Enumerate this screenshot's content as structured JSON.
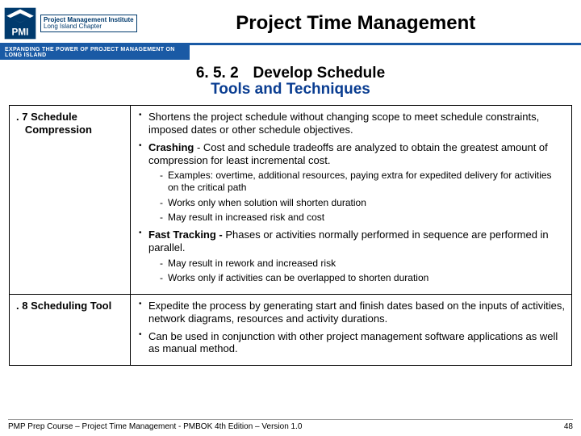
{
  "header": {
    "logo": {
      "line1": "Project Management Institute",
      "line2": "Long Island Chapter"
    },
    "tagline": "Expanding the Power of Project Management on Long Island",
    "title": "Project Time Management"
  },
  "section": {
    "number": "6. 5. 2",
    "name": "Develop Schedule",
    "subtitle": "Tools and Techniques"
  },
  "rows": [
    {
      "num": ". 7 ",
      "title_l1": "Schedule",
      "title_l2": "Compression",
      "bullets": [
        {
          "text": "Shortens the project schedule without changing scope to meet schedule constraints, imposed dates or other schedule objectives."
        },
        {
          "lead": "Crashing",
          "text": " - Cost and schedule tradeoffs are analyzed to obtain the greatest amount of compression for least incremental cost.",
          "subs": [
            "Examples: overtime, additional resources, paying extra for expedited delivery for activities on the critical path",
            "Works only when solution will shorten duration",
            "May result in increased risk and cost"
          ]
        },
        {
          "lead": "Fast Tracking -",
          "text": " Phases or activities normally performed in sequence are performed in parallel.",
          "subs": [
            "May result in rework and increased risk",
            "Works only if activities can be overlapped to shorten duration"
          ]
        }
      ]
    },
    {
      "num": ". 8 ",
      "title_l1": "Scheduling Tool",
      "bullets": [
        {
          "text": "Expedite the process by generating start and finish dates based on the inputs of activities, network diagrams, resources and activity durations."
        },
        {
          "text": "Can be used in conjunction with other project management software applications as well as manual method."
        }
      ]
    }
  ],
  "footer": {
    "text": "PMP Prep Course – Project Time Management - PMBOK 4th Edition – Version 1.0",
    "page": "48"
  }
}
